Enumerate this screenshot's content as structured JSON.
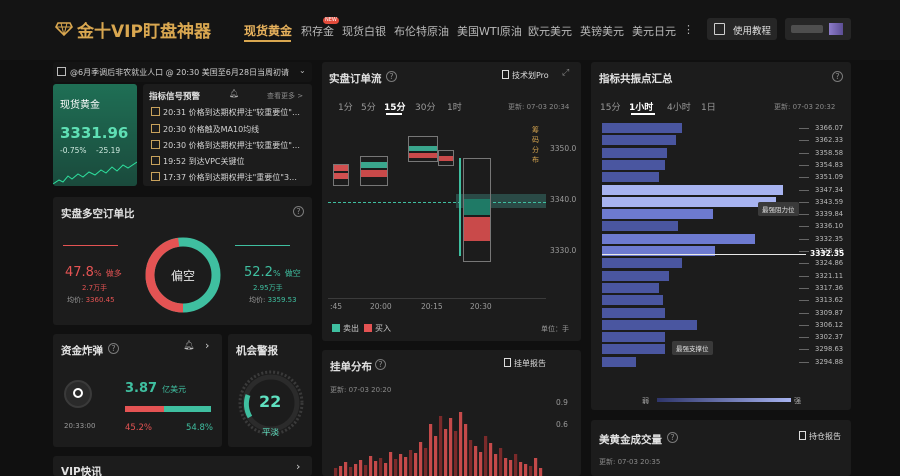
{
  "header": {
    "logo_icon": "gem-icon",
    "logo_text": "金十VIP盯盘神器",
    "nav": [
      {
        "label": "现货黄金",
        "active": true
      },
      {
        "label": "积存金",
        "badge": "NEW"
      },
      {
        "label": "现货白银"
      },
      {
        "label": "布伦特原油"
      },
      {
        "label": "美国WTI原油"
      },
      {
        "label": "欧元美元"
      },
      {
        "label": "英镑美元"
      },
      {
        "label": "美元日元"
      }
    ],
    "more": "⋮",
    "tutorial_label": "使用教程"
  },
  "ticker": {
    "text": "@6月季调后非农就业人口 @ 20:30 美国至6月28日当周初请"
  },
  "quote": {
    "name": "现货黄金",
    "price": "3331.96",
    "change_pct": "-0.75%",
    "change": "-25.19"
  },
  "signals": {
    "title": "指标信号预警",
    "more": "查看更多 >",
    "items": [
      {
        "time": "20:31",
        "text": "价格到达期权押注\"较重要位\"…"
      },
      {
        "time": "20:30",
        "text": "价格触及MA10均线"
      },
      {
        "time": "20:30",
        "text": "价格到达期权押注\"较重要位\"…"
      },
      {
        "time": "19:52",
        "text": "到达VPC关键位"
      },
      {
        "time": "17:37",
        "text": "价格到达期权押注\"重要位\"3…"
      }
    ]
  },
  "longshort": {
    "title": "实盘多空订单比",
    "center": "偏空",
    "long_pct": "47.8",
    "long_label": "做多",
    "long_hands": "2.7万手",
    "long_avg_label": "均价:",
    "long_avg": "3360.45",
    "short_pct": "52.2",
    "short_label": "做空",
    "short_hands": "2.95万手",
    "short_avg_label": "均价:",
    "short_avg": "3359.53",
    "long_fraction": 0.478
  },
  "funds": {
    "title": "资金炸弹",
    "amount": "3.87",
    "unit": "亿美元",
    "time": "20:33:00",
    "left_pct": "45.2%",
    "right_pct": "54.8%",
    "left_fraction": 0.452
  },
  "alert": {
    "title": "机会警报",
    "value": "22",
    "label": "平淡"
  },
  "vip": {
    "title": "VIP快讯"
  },
  "orderflow": {
    "title": "实盘订单流",
    "link": "技术划Pro",
    "tabs": [
      "1分",
      "5分",
      "15分",
      "30分",
      "1时"
    ],
    "active_tab": "15分",
    "updated": "更新: 07-03 20:34",
    "side_label": "筹码分布",
    "y_ticks": [
      "3350.0",
      "3340.0",
      "3330.0"
    ],
    "x_ticks": [
      ":45",
      "20:00",
      "20:15",
      "20:30"
    ],
    "legend_sell": "卖出",
    "legend_buy": "买入",
    "unit": "单位：手"
  },
  "resonance": {
    "title": "指标共振点汇总",
    "tabs": [
      "15分",
      "1小时",
      "4小时",
      "1日"
    ],
    "active_tab": "1小时",
    "updated": "更新: 07-03 20:32",
    "levels": [
      "3366.07",
      "3362.33",
      "3358.58",
      "3354.83",
      "3351.09",
      "3347.34",
      "3343.59",
      "3339.84",
      "3336.10",
      "3332.35",
      "3328.60",
      "3324.86",
      "3321.11",
      "3317.36",
      "3313.62",
      "3309.87",
      "3306.12",
      "3302.37",
      "3298.63",
      "3294.88"
    ],
    "bar_strengths": [
      0.38,
      0.35,
      0.31,
      0.3,
      0.27,
      0.86,
      0.83,
      0.53,
      0.36,
      0.73,
      0.54,
      0.38,
      0.32,
      0.27,
      0.29,
      0.3,
      0.45,
      0.3,
      0.3,
      0.16
    ],
    "current_price": "3332.35",
    "strong_resistance": "最强阻力位",
    "strong_support": "最强支撑位",
    "legend_weak": "弱",
    "legend_strong": "强"
  },
  "pending": {
    "title": "挂单分布",
    "link": "挂单报告",
    "updated": "更新: 07-03 20:20",
    "y_ticks": [
      "0.9",
      "0.6"
    ]
  },
  "volume": {
    "title": "美黄金成交量",
    "link": "持仓报告",
    "updated": "更新: 07-03 20:35"
  },
  "colors": {
    "gold": "#d9a750",
    "up": "#3fbfa0",
    "down": "#e45353",
    "bar": "#4a56a0",
    "bar_strong": "#a7b3f0"
  }
}
